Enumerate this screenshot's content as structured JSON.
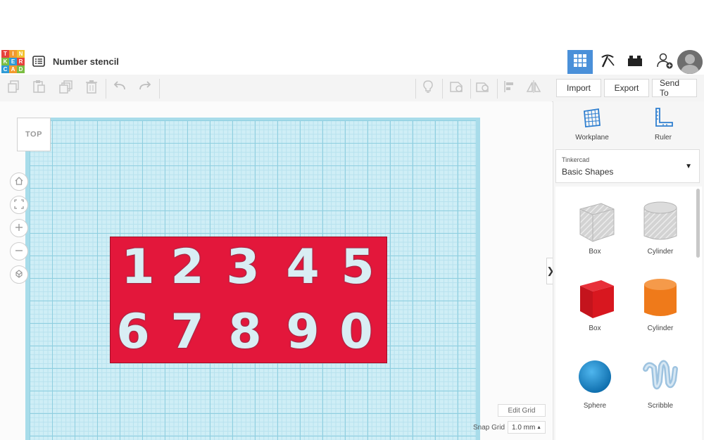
{
  "app": {
    "logo_letters": [
      "T",
      "I",
      "N",
      "K",
      "E",
      "R",
      "C",
      "A",
      "D"
    ],
    "logo_colors": [
      "#e6423c",
      "#f29a2e",
      "#f2c12e",
      "#7bbd42",
      "#2e9bd6",
      "#e6423c",
      "#2e9bd6",
      "#f29a2e",
      "#7bbd42"
    ],
    "document_title": "Number stencil"
  },
  "header": {
    "views": [
      {
        "name": "3d-view",
        "icon": "grid-icon",
        "active": true
      },
      {
        "name": "blocks",
        "icon": "pickaxe-icon",
        "active": false
      },
      {
        "name": "bricks",
        "icon": "brick-icon",
        "active": false
      }
    ],
    "accent_color": "#4a90d9"
  },
  "toolbar": {
    "left_tools": [
      "copy-icon",
      "paste-icon",
      "duplicate-icon",
      "trash-icon",
      "undo-icon",
      "redo-icon"
    ],
    "right_tools": [
      "light-icon",
      "group-shape-icon",
      "hole-shape-icon",
      "align-icon",
      "mirror-icon"
    ],
    "import_label": "Import",
    "export_label": "Export",
    "sendto_label": "Send To"
  },
  "viewcube": {
    "label": "TOP"
  },
  "nav": [
    "home-icon",
    "fit-icon",
    "zoom-in-icon",
    "zoom-out-icon",
    "orbit-icon"
  ],
  "stencil": {
    "row1": [
      "1",
      "2",
      "3",
      "4",
      "5"
    ],
    "row2": [
      "6",
      "7",
      "8",
      "9",
      "0"
    ],
    "color": "#e3173b"
  },
  "grid_controls": {
    "edit_grid_label": "Edit Grid",
    "snap_grid_label": "Snap Grid",
    "snap_grid_value": "1.0 mm"
  },
  "panel": {
    "workplane_label": "Workplane",
    "ruler_label": "Ruler",
    "library_provider": "Tinkercad",
    "library_name": "Basic Shapes",
    "shapes": [
      {
        "label": "Box",
        "icon": "box-hole-icon"
      },
      {
        "label": "Cylinder",
        "icon": "cylinder-hole-icon"
      },
      {
        "label": "Box",
        "icon": "box-icon",
        "color": "#d8171f"
      },
      {
        "label": "Cylinder",
        "icon": "cylinder-icon",
        "color": "#ef7a1a"
      },
      {
        "label": "Sphere",
        "icon": "sphere-icon",
        "color": "#1b8ed0"
      },
      {
        "label": "Scribble",
        "icon": "scribble-icon",
        "color": "#8fb6d6"
      }
    ]
  }
}
